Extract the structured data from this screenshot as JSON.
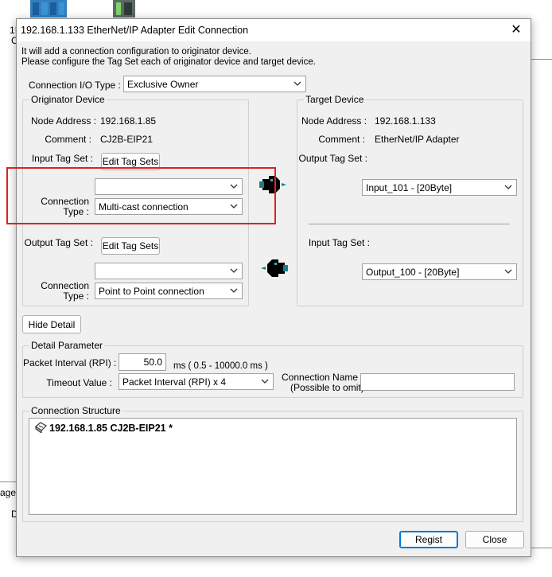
{
  "background": {
    "left_fragment_1": "1!",
    "left_fragment_2": "C",
    "left_fragment_3": "age c",
    "left_fragment_4": "D"
  },
  "dialog": {
    "title": "192.168.1.133 EtherNet/IP Adapter Edit Connection",
    "close_glyph": "✕",
    "intro_line1": "It will add a connection configuration to originator device.",
    "intro_line2": "Please configure the Tag Set each of originator device and target device.",
    "connection_io_type": {
      "label": "Connection I/O Type :",
      "value": "Exclusive Owner"
    },
    "originator": {
      "title": "Originator Device",
      "node_address_label": "Node Address :",
      "node_address": "192.168.1.85",
      "comment_label": "Comment :",
      "comment": "CJ2B-EIP21",
      "input_tag_set_label": "Input Tag Set :",
      "edit_tag_sets_label": "Edit Tag Sets",
      "input_tag_combo_value": "",
      "connection_type_label_1": "Connection",
      "connection_type_label_2": "Type :",
      "input_connection_type": "Multi-cast connection",
      "output_tag_set_label": "Output Tag Set :",
      "edit_tag_sets_label_2": "Edit Tag Sets",
      "output_tag_combo_value": "",
      "output_connection_type": "Point to Point connection"
    },
    "target": {
      "title": "Target Device",
      "node_address_label": "Node Address :",
      "node_address": "192.168.1.133",
      "comment_label": "Comment :",
      "comment": "EtherNet/IP Adapter",
      "output_tag_set_label": "Output Tag Set :",
      "output_tag_set_value": "Input_101 - [20Byte]",
      "input_tag_set_label": "Input Tag Set :",
      "input_tag_set_value": "Output_100 - [20Byte]"
    },
    "hide_detail_label": "Hide Detail",
    "detail": {
      "title": "Detail Parameter",
      "rpi_label": "Packet Interval (RPI) :",
      "rpi_value": "50.0",
      "rpi_range": "ms ( 0.5 - 10000.0 ms )",
      "timeout_label": "Timeout Value :",
      "timeout_value": "Packet Interval (RPI) x 4",
      "connection_name_label_1": "Connection Name :",
      "connection_name_label_2": "(Possible to omit)",
      "connection_name_value": ""
    },
    "structure": {
      "title": "Connection Structure",
      "item": "192.168.1.85 CJ2B-EIP21 *"
    },
    "regist_label": "Regist",
    "close_label": "Close"
  },
  "colors": {
    "highlight_box": "#e02020",
    "dialog_bg": "#f0f0f0",
    "default_button_border": "#0078d7"
  }
}
